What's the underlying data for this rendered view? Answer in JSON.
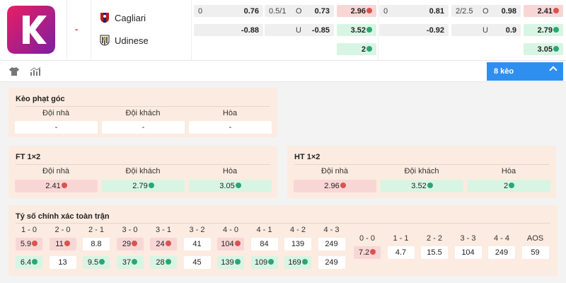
{
  "match": {
    "status_dash": "-",
    "home_team": "Cagliari",
    "away_team": "Udinese"
  },
  "odds_rows": [
    [
      {
        "l": "0",
        "m": "",
        "r": "0.76",
        "tone": ""
      },
      {
        "l": "0.5/1",
        "m": "O",
        "r": "0.73",
        "tone": ""
      },
      {
        "l": "",
        "m": "",
        "r": "2.96",
        "tone": "red",
        "arrow": "down"
      },
      {
        "l": "0",
        "m": "",
        "r": "0.81",
        "tone": ""
      },
      {
        "l": "2/2.5",
        "m": "O",
        "r": "0.98",
        "tone": ""
      },
      {
        "l": "",
        "m": "",
        "r": "2.41",
        "tone": "red",
        "arrow": "down"
      }
    ],
    [
      {
        "l": "",
        "m": "",
        "r": "-0.88",
        "tone": ""
      },
      {
        "l": "",
        "m": "U",
        "r": "-0.85",
        "tone": ""
      },
      {
        "l": "",
        "m": "",
        "r": "3.52",
        "tone": "green",
        "arrow": "up"
      },
      {
        "l": "",
        "m": "",
        "r": "-0.92",
        "tone": ""
      },
      {
        "l": "",
        "m": "U",
        "r": "0.9",
        "tone": ""
      },
      {
        "l": "",
        "m": "",
        "r": "2.79",
        "tone": "green",
        "arrow": "up"
      }
    ],
    [
      {
        "r": "2",
        "tone": "green",
        "arrow": "up"
      },
      {
        "r": "3.05",
        "tone": "green",
        "arrow": "up"
      }
    ]
  ],
  "toolbar": {
    "keo_label": "8 kèo",
    "icons": [
      "shirt-icon",
      "stats-icon"
    ]
  },
  "corner": {
    "title": "Kèo phạt góc",
    "headers": [
      "Đội nhà",
      "Đội khách",
      "Hòa"
    ],
    "values": [
      "-",
      "-",
      "-"
    ]
  },
  "ft": {
    "title": "FT 1×2",
    "headers": [
      "Đội nhà",
      "Đội khách",
      "Hòa"
    ],
    "values": [
      {
        "v": "2.41",
        "tone": "red",
        "arrow": "down"
      },
      {
        "v": "2.79",
        "tone": "green",
        "arrow": "up"
      },
      {
        "v": "3.05",
        "tone": "green",
        "arrow": "up"
      }
    ]
  },
  "ht": {
    "title": "HT 1×2",
    "headers": [
      "Đội nhà",
      "Đội khách",
      "Hòa"
    ],
    "values": [
      {
        "v": "2.96",
        "tone": "red",
        "arrow": "down"
      },
      {
        "v": "3.52",
        "tone": "green",
        "arrow": "up"
      },
      {
        "v": "2",
        "tone": "green",
        "arrow": "up"
      }
    ]
  },
  "correct_score": {
    "title": "Tỷ số chính xác toàn trận",
    "left_headers": [
      "1 - 0",
      "2 - 0",
      "2 - 1",
      "3 - 0",
      "3 - 1",
      "3 - 2",
      "4 - 0",
      "4 - 1",
      "4 - 2",
      "4 - 3"
    ],
    "left_home": [
      {
        "v": "5.9",
        "tone": "red",
        "arrow": "down"
      },
      {
        "v": "11",
        "tone": "red",
        "arrow": "down"
      },
      {
        "v": "8.8",
        "tone": "",
        "arrow": ""
      },
      {
        "v": "29",
        "tone": "red",
        "arrow": "down"
      },
      {
        "v": "24",
        "tone": "red",
        "arrow": "down"
      },
      {
        "v": "41",
        "tone": "",
        "arrow": ""
      },
      {
        "v": "104",
        "tone": "red",
        "arrow": "down"
      },
      {
        "v": "84",
        "tone": "",
        "arrow": ""
      },
      {
        "v": "139",
        "tone": "",
        "arrow": ""
      },
      {
        "v": "249",
        "tone": "",
        "arrow": ""
      }
    ],
    "left_away": [
      {
        "v": "6.4",
        "tone": "green",
        "arrow": "up"
      },
      {
        "v": "13",
        "tone": "",
        "arrow": ""
      },
      {
        "v": "9.5",
        "tone": "green",
        "arrow": "up"
      },
      {
        "v": "37",
        "tone": "green",
        "arrow": "up"
      },
      {
        "v": "28",
        "tone": "green",
        "arrow": "up"
      },
      {
        "v": "45",
        "tone": "",
        "arrow": ""
      },
      {
        "v": "139",
        "tone": "green",
        "arrow": "up"
      },
      {
        "v": "109",
        "tone": "green",
        "arrow": "up"
      },
      {
        "v": "169",
        "tone": "green",
        "arrow": "up"
      },
      {
        "v": "249",
        "tone": "",
        "arrow": ""
      }
    ],
    "right_headers": [
      "0 - 0",
      "1 - 1",
      "2 - 2",
      "3 - 3",
      "4 - 4",
      "AOS"
    ],
    "right_values": [
      {
        "v": "7.2",
        "tone": "red",
        "arrow": "down"
      },
      {
        "v": "4.7",
        "tone": "",
        "arrow": ""
      },
      {
        "v": "15.5",
        "tone": "",
        "arrow": ""
      },
      {
        "v": "104",
        "tone": "",
        "arrow": ""
      },
      {
        "v": "249",
        "tone": "",
        "arrow": ""
      },
      {
        "v": "59",
        "tone": "",
        "arrow": ""
      }
    ]
  },
  "colors": {
    "accent": "#2f8ff0",
    "logo": "#c2185b",
    "up": "#2aa772",
    "down": "#d9534f",
    "panel": "#fcebe0"
  }
}
